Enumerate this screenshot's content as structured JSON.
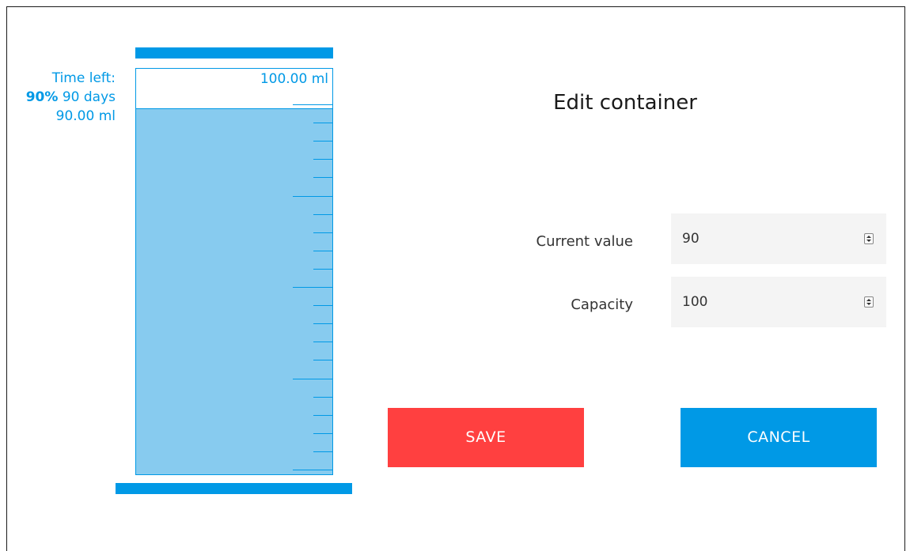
{
  "gauge": {
    "time_left_label": "Time left:",
    "percent": "90%",
    "days": "90 days",
    "volume": "90.00 ml",
    "capacity_label": "100.00 ml",
    "fill_fraction": 0.9,
    "colors": {
      "accent": "#0099e6",
      "fill": "#87cbef"
    }
  },
  "form": {
    "title": "Edit container",
    "current_value_label": "Current value",
    "current_value": "90",
    "capacity_label": "Capacity",
    "capacity_value": "100",
    "spinner_icon": "spinner-up-down-icon"
  },
  "buttons": {
    "save_label": "SAVE",
    "save_color": "#ff4040",
    "cancel_label": "CANCEL",
    "cancel_color": "#0099e6"
  }
}
